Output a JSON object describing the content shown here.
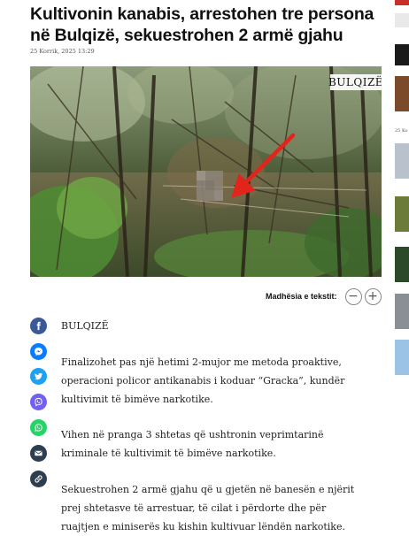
{
  "article": {
    "title": "Kultivonin kanabis, arrestohen tre persona në Bulqizë, sekuestrohen 2 armë gjahu",
    "date": "25 Korrik, 2025 13:29",
    "image": {
      "watermark": "BULQIZË",
      "alt": "Kanabis i kultivuar në pyll"
    },
    "paragraphs": [
      "BULQIZË",
      "Finalizohet pas një hetimi 2-mujor me metoda proaktive, operacioni policor antikanabis i koduar “Gracka”, kundër kultivimit të bimëve narkotike.",
      "Vihen në pranga 3 shtetas që ushtronin veprimtarinë kriminale të kultivimit të bimëve narkotike.",
      "Sekuestrohen 2 armë gjahu që u gjetën në banesën e njërit prej shtetasve të arrestuar, të cilat i përdorte dhe për ruajtjen e miniserës ku kishin kultivuar lëndën narkotike."
    ]
  },
  "text_size": {
    "label": "Madhësia e tekstit:",
    "decrease": "−",
    "increase": "+"
  },
  "share": [
    {
      "icon": "facebook-icon",
      "color": "#3b5998"
    },
    {
      "icon": "messenger-icon",
      "color": "#0a7cff"
    },
    {
      "icon": "twitter-icon",
      "color": "#1da1f2"
    },
    {
      "icon": "viber-icon",
      "color": "#7360f2"
    },
    {
      "icon": "whatsapp-icon",
      "color": "#25d366"
    },
    {
      "icon": "email-icon",
      "color": "#2d3e50"
    },
    {
      "icon": "link-icon",
      "color": "#2d3e50"
    }
  ],
  "sidebar": {
    "date_fragment": "25 Ko"
  }
}
